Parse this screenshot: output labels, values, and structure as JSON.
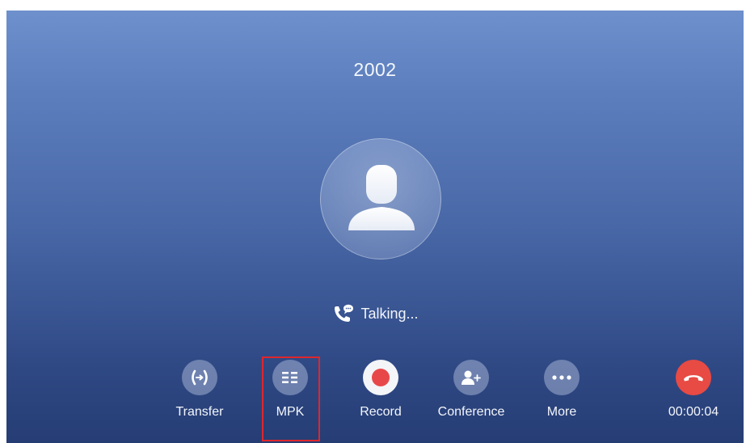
{
  "call": {
    "number": "2002",
    "status": "Talking...",
    "duration": "00:00:04"
  },
  "actions": [
    {
      "label": "Transfer",
      "icon": "transfer-icon"
    },
    {
      "label": "MPK",
      "icon": "mpk-grid-icon"
    },
    {
      "label": "Record",
      "icon": "record-icon"
    },
    {
      "label": "Conference",
      "icon": "add-person-icon"
    },
    {
      "label": "More",
      "icon": "more-dots-icon"
    }
  ],
  "hangup": {
    "icon": "hangup-icon"
  },
  "colors": {
    "background_top": "#6e90cc",
    "background_bottom": "#263d74",
    "record_red": "#e8474a",
    "hangup_red": "#e84a44",
    "highlight_red": "#e0262c"
  }
}
